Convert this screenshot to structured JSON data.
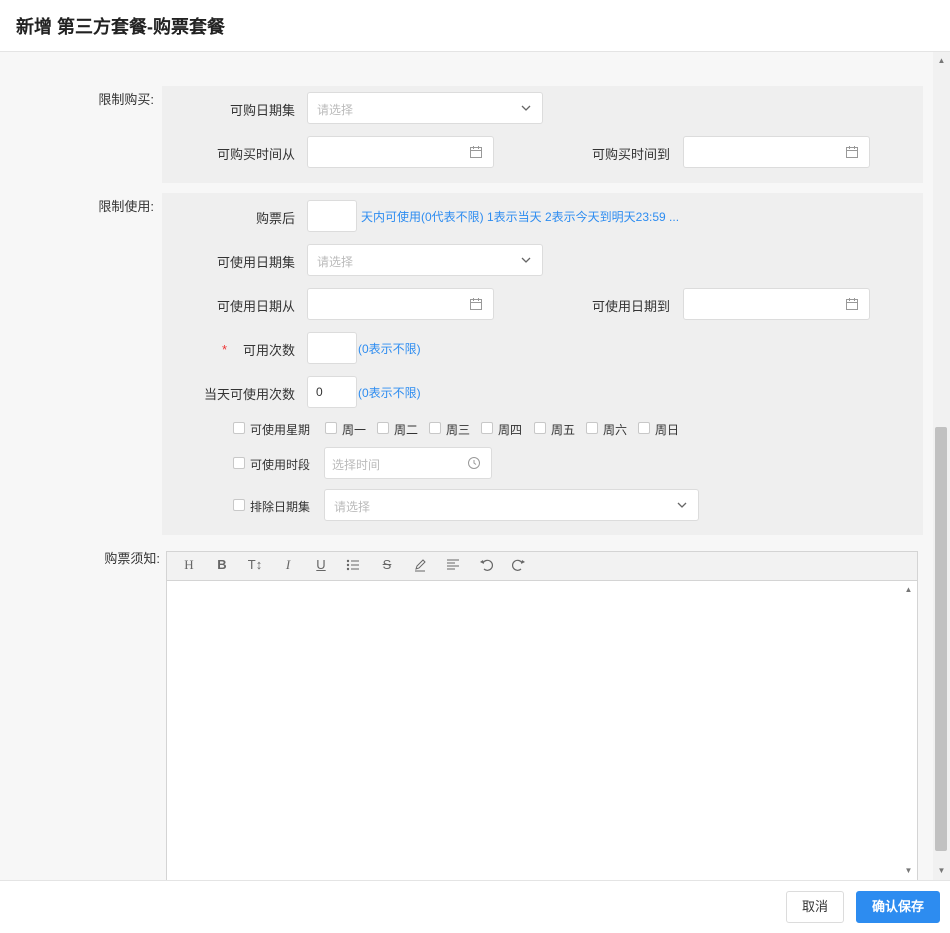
{
  "dialog": {
    "title": "新增 第三方套餐-购票套餐"
  },
  "purchase_limit": {
    "section_label": "限制购买:",
    "date_set_label": "可购日期集",
    "date_set_placeholder": "请选择",
    "time_from_label": "可购买时间从",
    "time_to_label": "可购买时间到"
  },
  "usage_limit": {
    "section_label": "限制使用:",
    "after_purchase_label": "购票后",
    "after_purchase_hint": "天内可使用(0代表不限) 1表示当天 2表示今天到明天23:59 ...",
    "date_set_label": "可使用日期集",
    "date_set_placeholder": "请选择",
    "date_from_label": "可使用日期从",
    "date_to_label": "可使用日期到",
    "required_mark": "*",
    "times_label": "可用次数",
    "times_hint": "(0表示不限)",
    "daily_times_label": "当天可使用次数",
    "daily_times_value": "0",
    "daily_times_hint": "(0表示不限)",
    "weekday_label": "可使用星期",
    "weekdays": [
      "周一",
      "周二",
      "周三",
      "周四",
      "周五",
      "周六",
      "周日"
    ],
    "period_label": "可使用时段",
    "period_placeholder": "选择时间",
    "exclude_label": "排除日期集",
    "exclude_placeholder": "请选择"
  },
  "notice": {
    "section_label": "购票须知:",
    "toolbar_icons": [
      "H",
      "B",
      "T↕",
      "I",
      "U",
      "list-icon",
      "S",
      "pen-icon",
      "align-icon",
      "undo-icon",
      "redo-icon"
    ]
  },
  "footer": {
    "cancel_label": "取消",
    "confirm_label": "确认保存"
  },
  "colors": {
    "accent": "#2d8cf0",
    "panel": "#efefef",
    "required": "#e33"
  }
}
